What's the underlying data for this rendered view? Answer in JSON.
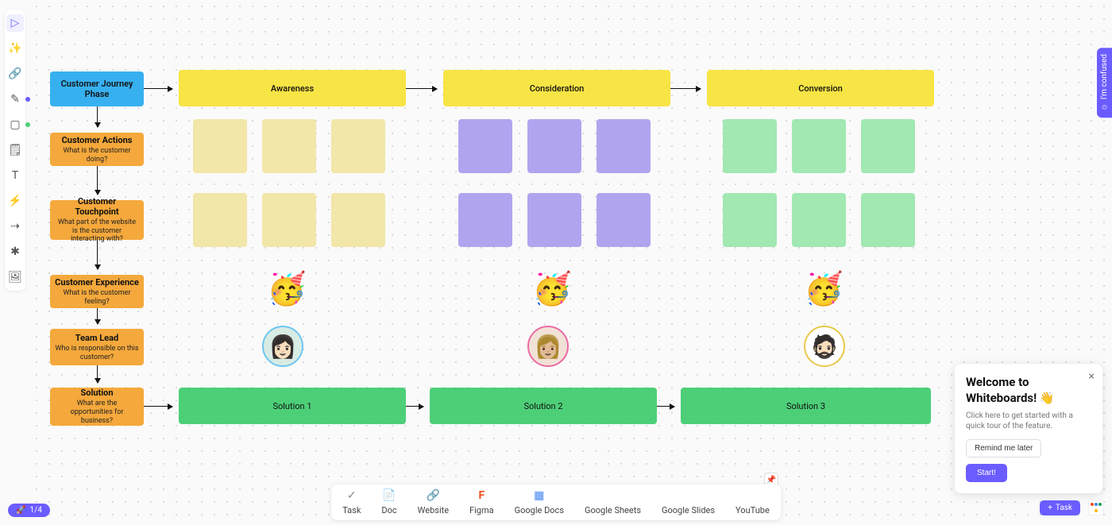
{
  "toolbar": {
    "items": [
      {
        "name": "cursor-icon",
        "glyph": "▷",
        "selected": true
      },
      {
        "name": "ai-icon",
        "glyph": "✨"
      },
      {
        "name": "link-icon",
        "glyph": "🔗"
      },
      {
        "name": "pen-icon",
        "glyph": "✎"
      },
      {
        "name": "shape-icon",
        "glyph": "▢"
      },
      {
        "name": "sticky-icon",
        "glyph": "🗒"
      },
      {
        "name": "text-icon",
        "glyph": "T"
      },
      {
        "name": "wand-icon",
        "glyph": "⚡"
      },
      {
        "name": "connector-icon",
        "glyph": "⇢"
      },
      {
        "name": "branch-icon",
        "glyph": "⎋"
      },
      {
        "name": "image-icon",
        "glyph": "🖼"
      }
    ]
  },
  "rows": {
    "phase": {
      "label": "Customer Journey Phase"
    },
    "actions": {
      "label": "Customer Actions",
      "sub": "What is the customer doing?"
    },
    "touchpoint": {
      "label": "Customer Touchpoint",
      "sub": "What part of the website is the customer interacting with?"
    },
    "experience": {
      "label": "Customer Experience",
      "sub": "What is the customer feeling?"
    },
    "teamlead": {
      "label": "Team Lead",
      "sub": "Who is responsible on this customer?"
    },
    "solution": {
      "label": "Solution",
      "sub": "What are the opportunities for business?"
    }
  },
  "phases": [
    "Awareness",
    "Consideration",
    "Conversion"
  ],
  "solutions": [
    "Solution 1",
    "Solution 2",
    "Solution 3"
  ],
  "emoji": "🥳",
  "avatars": [
    {
      "border": "#6ec6f0",
      "bg": "#cfe9e0"
    },
    {
      "border": "#ec6aa5",
      "bg": "#f0dcd2"
    },
    {
      "border": "#e9c94b",
      "bg": "#f5f0e6"
    }
  ],
  "dock": [
    {
      "name": "task",
      "label": "Task",
      "glyph": "✓"
    },
    {
      "name": "doc",
      "label": "Doc",
      "glyph": "📄"
    },
    {
      "name": "website",
      "label": "Website",
      "glyph": "🔗"
    },
    {
      "name": "figma",
      "label": "Figma",
      "glyph": "F"
    },
    {
      "name": "gdocs",
      "label": "Google Docs",
      "glyph": "📘"
    },
    {
      "name": "gsheets",
      "label": "Google Sheets",
      "glyph": ""
    },
    {
      "name": "gslides",
      "label": "Google Slides",
      "glyph": ""
    },
    {
      "name": "youtube",
      "label": "YouTube",
      "glyph": ""
    }
  ],
  "popup": {
    "title": "Welcome to Whiteboards! 👋",
    "body": "Click here to get started with a quick tour of the feature.",
    "remind": "Remind me later",
    "start": "Start!"
  },
  "confused": "I'm confused",
  "progress": "1/4",
  "task_btn": "Task"
}
